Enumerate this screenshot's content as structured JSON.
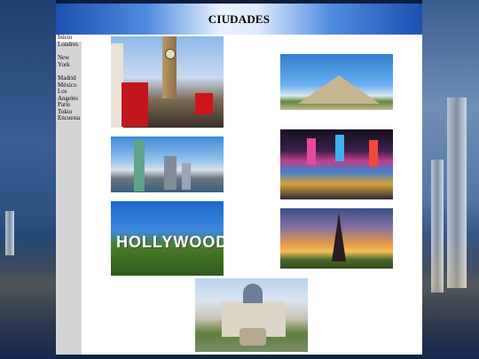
{
  "page": {
    "title": "CIUDADES"
  },
  "nav": {
    "items": [
      {
        "label": "Inicio",
        "active": true
      },
      {
        "label": "Londres"
      },
      {
        "label": "New York"
      },
      {
        "label": "Madrid"
      },
      {
        "label": "México"
      },
      {
        "label": "Los Angeles"
      },
      {
        "label": "Paris"
      },
      {
        "label": "Tokio"
      },
      {
        "label": "Encuesta"
      }
    ]
  },
  "photos": {
    "hollywood_sign_text": "HOLLYWOOD"
  },
  "colors": {
    "header_blue": "#1c4fb0",
    "sidebar_gray": "#d4d4d4",
    "page_white": "#ffffff"
  }
}
